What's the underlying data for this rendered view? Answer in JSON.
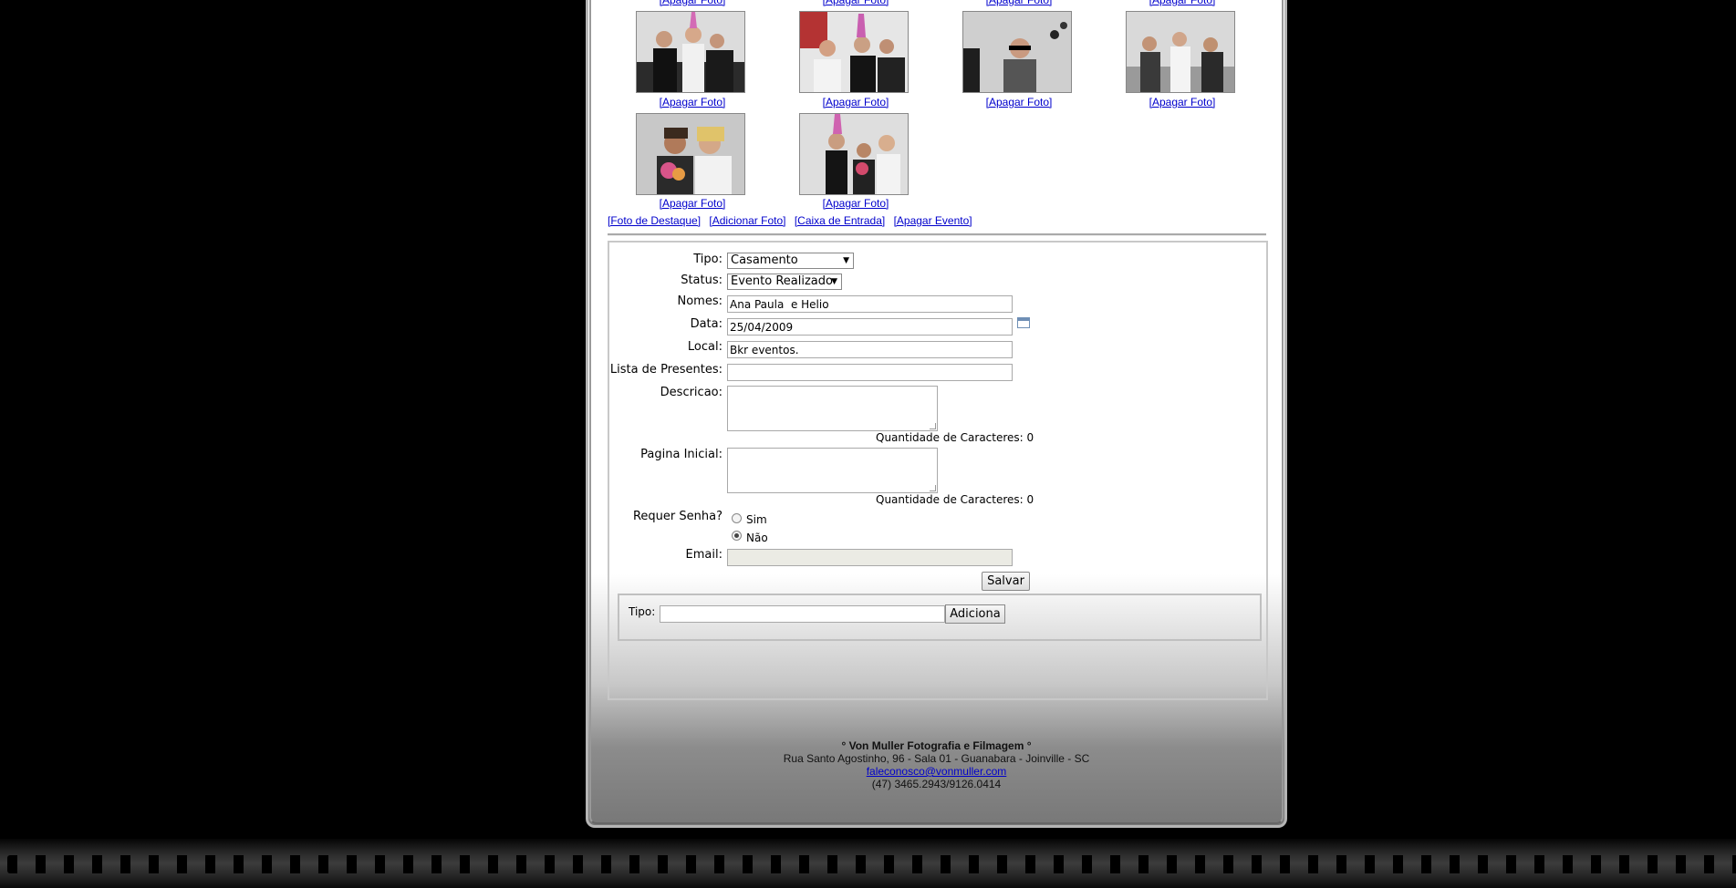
{
  "gallery": {
    "delete_label": "[Apagar Foto]"
  },
  "actions": [
    "[Foto de Destaque]",
    "[Adicionar Foto]",
    "[Caixa de Entrada]",
    "[Apagar Evento]"
  ],
  "form": {
    "tipo_label": "Tipo:",
    "tipo_value": "Casamento",
    "status_label": "Status:",
    "status_value": "Evento Realizado",
    "nomes_label": "Nomes:",
    "nomes_value": "Ana Paula  e Helio",
    "data_label": "Data:",
    "data_value": "25/04/2009",
    "local_label": "Local:",
    "local_value": "Bkr eventos.",
    "lista_label": "Lista de Presentes:",
    "lista_value": "",
    "descricao_label": "Descricao:",
    "descricao_count": "Quantidade de Caracteres: 0",
    "pagina_label": "Pagina Inicial:",
    "pagina_count": "Quantidade de Caracteres: 0",
    "senha_label": "Requer Senha?",
    "senha_sim": "Sim",
    "senha_nao": "Não",
    "senha_selected": "Não",
    "email_label": "Email:",
    "email_value": "",
    "save_label": "Salvar"
  },
  "tipo_add": {
    "label": "Tipo:",
    "value": "",
    "button": "Adiciona"
  },
  "footer": {
    "company": "° Von Muller Fotografia e Filmagem °",
    "address": "Rua Santo Agostinho, 96 - Sala 01 - Guanabara - Joinville - SC",
    "email": "faleconosco@vonmuller.com",
    "phone": "(47) 3465.2943/9126.0414"
  }
}
